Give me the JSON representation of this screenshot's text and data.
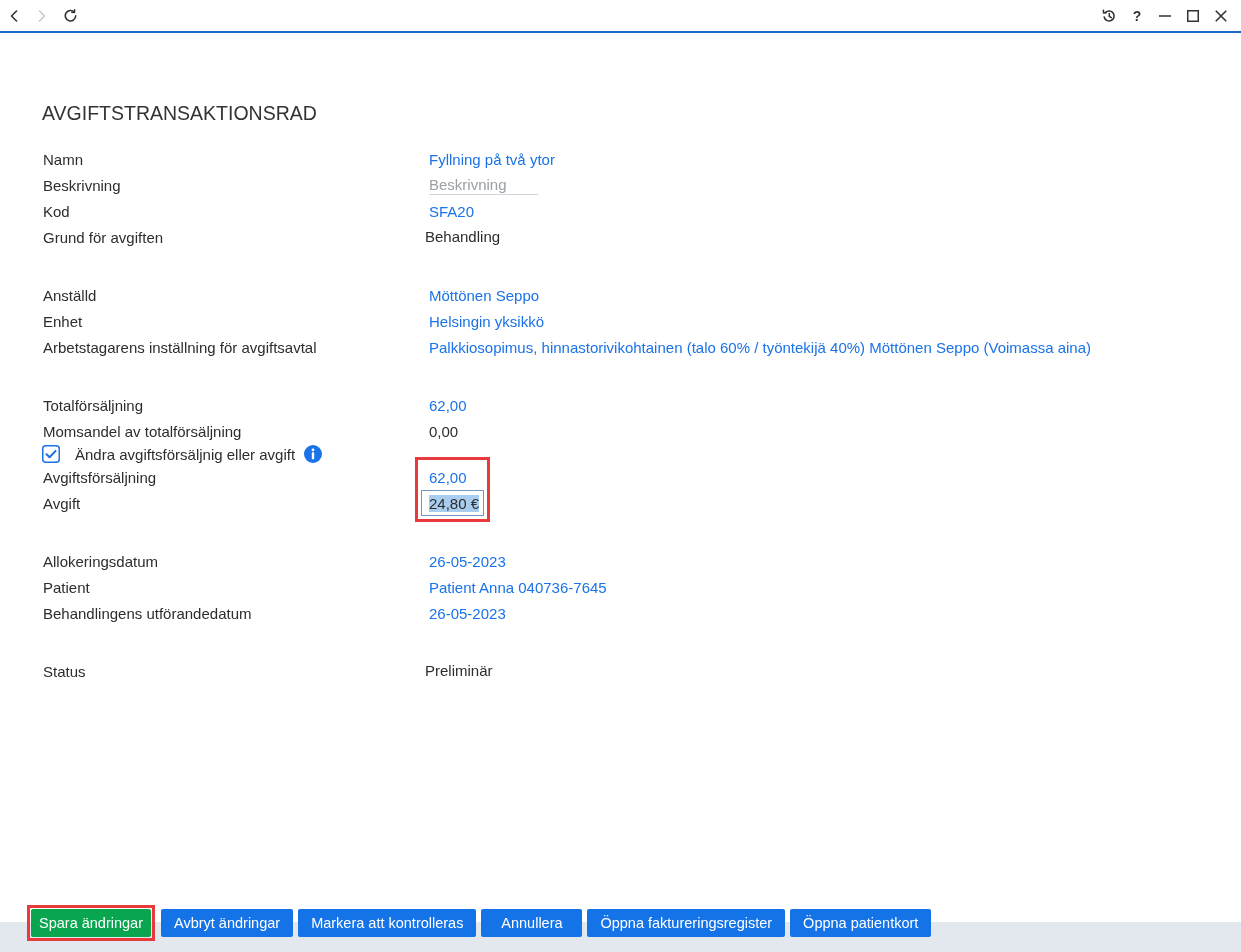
{
  "top_bar": {
    "navigation": [
      {
        "kind": "back",
        "disabled": false
      },
      {
        "kind": "forward",
        "disabled": true
      },
      {
        "kind": "refresh",
        "disabled": false
      }
    ],
    "window_controls": [
      {
        "kind": "history"
      },
      {
        "kind": "help",
        "label": "?"
      },
      {
        "kind": "minimize"
      },
      {
        "kind": "maximize"
      },
      {
        "kind": "close"
      }
    ]
  },
  "title": "AVGIFTSTRANSAKTIONSRAD",
  "sections": [
    {
      "items": [
        {
          "kind": "field",
          "label": "Namn",
          "value": {
            "kind": "link",
            "text": "Fyllning på två ytor"
          },
          "highlighted": false
        },
        {
          "kind": "field",
          "label": "Beskrivning",
          "value": {
            "kind": "editable",
            "placeholder": "Beskrivning"
          },
          "highlighted": false
        },
        {
          "kind": "field",
          "label": "Kod",
          "value": {
            "kind": "link",
            "text": "SFA20"
          },
          "highlighted": false
        },
        {
          "kind": "field",
          "label": "Grund för avgiften",
          "value": {
            "kind": "static",
            "text": "Behandling"
          },
          "highlighted": false
        }
      ]
    },
    {
      "items": [
        {
          "kind": "field",
          "label": "Anställd",
          "value": {
            "kind": "link",
            "text": "Möttönen Seppo"
          },
          "highlighted": false
        },
        {
          "kind": "field",
          "label": "Enhet",
          "value": {
            "kind": "link",
            "text": "Helsingin yksikkö"
          },
          "highlighted": false
        },
        {
          "kind": "field",
          "label": "Arbetstagarens inställning för avgiftsavtal",
          "value": {
            "kind": "link",
            "text": "Palkkiosopimus, hinnastorivikohtainen (talo 60% / työntekijä 40%) Möttönen Seppo (Voimassa aina)"
          },
          "highlighted": false
        }
      ]
    },
    {
      "items": [
        {
          "kind": "field",
          "label": "Totalförsäljning",
          "value": {
            "kind": "link",
            "text": "62,00"
          },
          "highlighted": false
        },
        {
          "kind": "field",
          "label": "Momsandel av totalförsäljning",
          "value": {
            "kind": "text",
            "text": "0,00"
          },
          "highlighted": false
        },
        {
          "kind": "checkbox",
          "label": "Ändra avgiftsförsäljnig eller avgift",
          "checked": true,
          "info": true
        },
        {
          "kind": "field",
          "label": "Avgiftsförsäljning",
          "value": {
            "kind": "link",
            "text": "62,00"
          },
          "highlighted": true
        },
        {
          "kind": "field",
          "label": "Avgift",
          "value": {
            "kind": "input",
            "text": "24,80 €",
            "text_highlighted": true
          },
          "highlighted": true
        }
      ]
    },
    {
      "items": [
        {
          "kind": "field",
          "label": "Allokeringsdatum",
          "value": {
            "kind": "link",
            "text": "26-05-2023"
          },
          "highlighted": false
        },
        {
          "kind": "field",
          "label": "Patient",
          "value": {
            "kind": "link",
            "text": "Patient Anna 040736-7645"
          },
          "highlighted": false
        },
        {
          "kind": "field",
          "label": "Behandlingens utförandedatum",
          "value": {
            "kind": "link",
            "text": "26-05-2023"
          },
          "highlighted": false
        }
      ]
    },
    {
      "items": [
        {
          "kind": "field",
          "label": "Status",
          "value": {
            "kind": "static",
            "text": "Preliminär"
          },
          "highlighted": false
        }
      ]
    }
  ],
  "actions": [
    {
      "label": "Spara ändringar",
      "kind": "confirm",
      "highlighted": true
    },
    {
      "label": "Avbryt ändringar",
      "kind": "action",
      "highlighted": false
    },
    {
      "label": "Markera att kontrolleras",
      "kind": "action",
      "highlighted": false
    },
    {
      "label": "Annullera",
      "kind": "action",
      "highlighted": false
    },
    {
      "label": "Öppna faktureringsregister",
      "kind": "action",
      "highlighted": false
    },
    {
      "label": "Öppna patientkort",
      "kind": "action",
      "highlighted": false
    }
  ]
}
